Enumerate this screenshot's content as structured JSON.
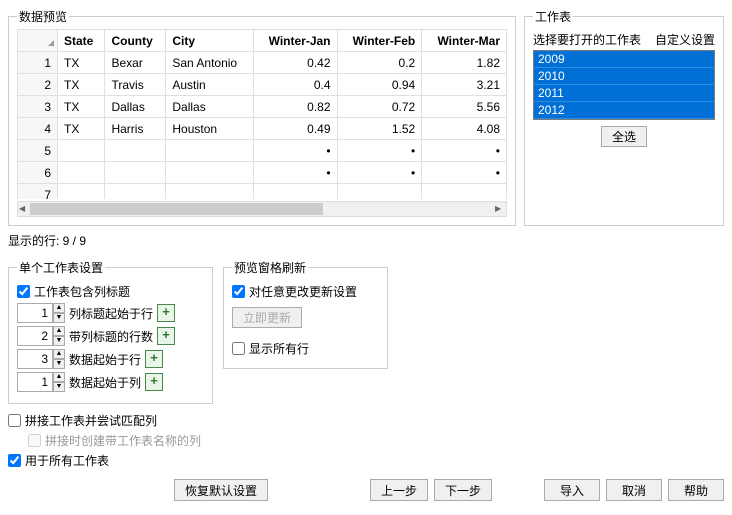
{
  "preview": {
    "legend": "数据预览",
    "columns": [
      "State",
      "County",
      "City",
      "Winter-Jan",
      "Winter-Feb",
      "Winter-Mar"
    ],
    "rows": [
      {
        "n": "1",
        "state": "TX",
        "county": "Bexar",
        "city": "San Antonio",
        "jan": "0.42",
        "feb": "0.2",
        "mar": "1.82"
      },
      {
        "n": "2",
        "state": "TX",
        "county": "Travis",
        "city": "Austin",
        "jan": "0.4",
        "feb": "0.94",
        "mar": "3.21"
      },
      {
        "n": "3",
        "state": "TX",
        "county": "Dallas",
        "city": "Dallas",
        "jan": "0.82",
        "feb": "0.72",
        "mar": "5.56"
      },
      {
        "n": "4",
        "state": "TX",
        "county": "Harris",
        "city": "Houston",
        "jan": "0.49",
        "feb": "1.52",
        "mar": "4.08"
      },
      {
        "n": "5",
        "state": "",
        "county": "",
        "city": "",
        "jan": "•",
        "feb": "•",
        "mar": "•"
      },
      {
        "n": "6",
        "state": "",
        "county": "",
        "city": "",
        "jan": "•",
        "feb": "•",
        "mar": "•"
      },
      {
        "n": "7",
        "state": "",
        "county": "",
        "city": "",
        "jan": "",
        "feb": "",
        "mar": ""
      }
    ]
  },
  "rows_info": "显示的行: 9 / 9",
  "sheets": {
    "legend": "工作表",
    "select_label": "选择要打开的工作表",
    "custom_label": "自定义设置",
    "items": [
      "2009",
      "2010",
      "2011",
      "2012"
    ],
    "select_all": "全选"
  },
  "single": {
    "legend": "单个工作表设置",
    "has_headers": "工作表包含列标题",
    "row1": {
      "val": "1",
      "label": "列标题起始于行"
    },
    "row2": {
      "val": "2",
      "label": "带列标题的行数"
    },
    "row3": {
      "val": "3",
      "label": "数据起始于行"
    },
    "row4": {
      "val": "1",
      "label": "数据起始于列"
    }
  },
  "refresh": {
    "legend": "预览窗格刷新",
    "on_change": "对任意更改更新设置",
    "now": "立即更新",
    "show_all": "显示所有行"
  },
  "bottom": {
    "concat": "拼接工作表并尝试匹配列",
    "create_col": "拼接时创建带工作表名称的列",
    "apply_all": "用于所有工作表"
  },
  "buttons": {
    "restore": "恢复默认设置",
    "prev": "上一步",
    "next": "下一步",
    "import": "导入",
    "cancel": "取消",
    "help": "帮助"
  }
}
